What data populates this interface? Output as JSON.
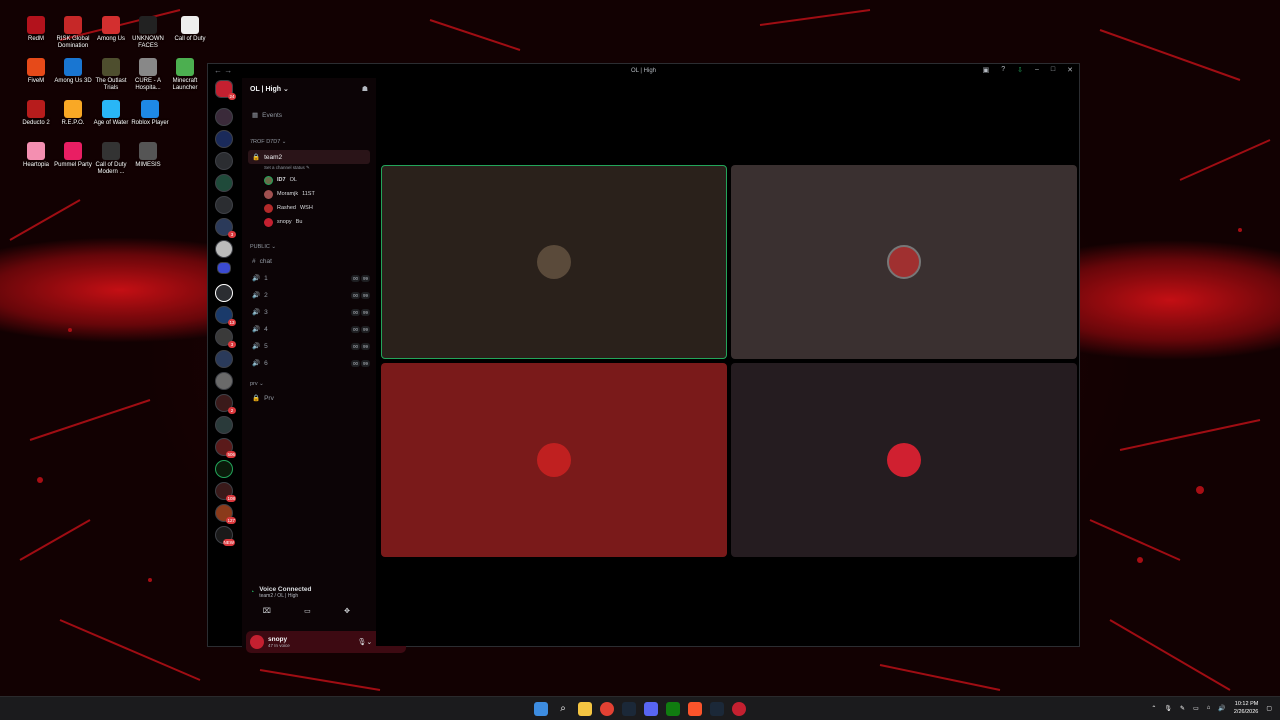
{
  "desktop": {
    "icons": [
      {
        "label": "RedM",
        "color": "#b3121c"
      },
      {
        "label": "RISK Global Domination",
        "color": "#c62828"
      },
      {
        "label": "Among Us",
        "color": "#d32f2f"
      },
      {
        "label": "UNKNOWN FACES",
        "color": "#222222"
      },
      {
        "label": "Call of Duty",
        "color": "#eeeeee"
      },
      {
        "label": "FiveM",
        "color": "#e64a19"
      },
      {
        "label": "Among Us 3D",
        "color": "#1976d2"
      },
      {
        "label": "The Outlast Trials",
        "color": "#4e4e2e"
      },
      {
        "label": "CURE - A Hospita...",
        "color": "#888888"
      },
      {
        "label": "Minecraft Launcher",
        "color": "#4caf50"
      },
      {
        "label": "Deducto 2",
        "color": "#b71c1c"
      },
      {
        "label": "R.E.P.O.",
        "color": "#f9a825"
      },
      {
        "label": "Age of Water",
        "color": "#29b6f6"
      },
      {
        "label": "Roblox Player",
        "color": "#1e88e5"
      },
      {
        "label": "Heartopia",
        "color": "#f48fb1"
      },
      {
        "label": "Pummel Party",
        "color": "#e91e63"
      },
      {
        "label": "Call of Duty Modern ...",
        "color": "#333333"
      },
      {
        "label": "MIMESIS",
        "color": "#555555"
      }
    ]
  },
  "window": {
    "title": "OL | High"
  },
  "server": {
    "name": "OL | High",
    "events_label": "Events",
    "categories": {
      "team": "7ROF D7D7",
      "public": "PUBLIC",
      "prv": "prv"
    },
    "voice_channel": {
      "name": "team2",
      "status": "Set a channel status",
      "users": [
        {
          "name": "ID7",
          "tag": "OL",
          "color": "#6b6b4a"
        },
        {
          "name": "Moramjk",
          "tag": "11ST",
          "color": "#a05050"
        },
        {
          "name": "Rashed",
          "tag": "WSH",
          "color": "#b42a2a"
        },
        {
          "name": "snopy",
          "tag": "Bu",
          "color": "#c42030"
        }
      ]
    },
    "text_channel": "chat",
    "voice_channels": [
      {
        "name": "1",
        "limit": [
          "00",
          "99"
        ]
      },
      {
        "name": "2",
        "limit": [
          "00",
          "99"
        ]
      },
      {
        "name": "3",
        "limit": [
          "00",
          "99"
        ]
      },
      {
        "name": "4",
        "limit": [
          "00",
          "99"
        ]
      },
      {
        "name": "5",
        "limit": [
          "00",
          "99"
        ]
      },
      {
        "name": "6",
        "limit": [
          "00",
          "99"
        ]
      }
    ],
    "prv_channel": "Prv"
  },
  "rail_badges": [
    "24",
    "3",
    "13",
    "3",
    "2",
    "506",
    "108",
    "127",
    "NEW"
  ],
  "voice_status": {
    "title": "Voice Connected",
    "location": "team2 / OL | High"
  },
  "user": {
    "name": "snopy",
    "status": "47 In voice"
  },
  "tiles": [
    {
      "bg": "#2a211b",
      "speaking": true,
      "avatar": "#5a4a3a"
    },
    {
      "bg": "#3a3030",
      "speaking": false,
      "avatar": "#a03030"
    },
    {
      "bg": "#7a1a1a",
      "speaking": false,
      "avatar": "#c02020"
    },
    {
      "bg": "#251c20",
      "speaking": false,
      "avatar": "#d02030"
    }
  ],
  "taskbar": {
    "time": "10:12 PM",
    "date": "2/26/2026"
  }
}
